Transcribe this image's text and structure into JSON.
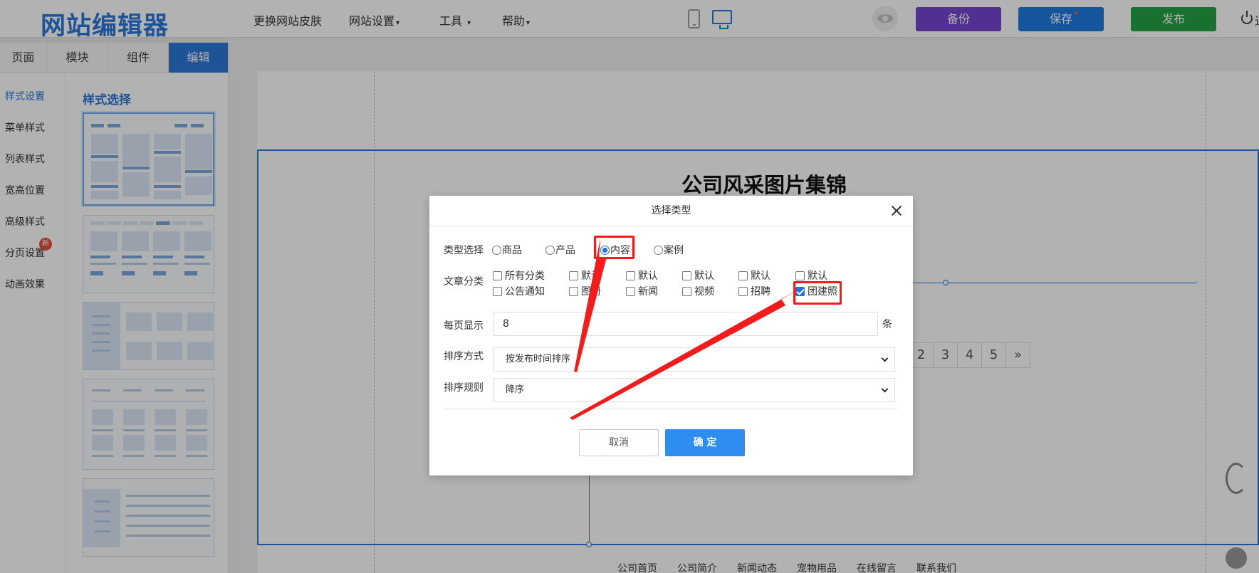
{
  "app": {
    "logo": "网站编辑器",
    "menu": [
      {
        "label": "更换网站皮肤",
        "dropdown": false
      },
      {
        "label": "网站设置",
        "dropdown": true
      },
      {
        "label": "工具",
        "dropdown": true
      },
      {
        "label": "帮助",
        "dropdown": true
      }
    ],
    "buttons": {
      "backup": "备份",
      "save": "保存",
      "publish": "发布"
    },
    "user_text": "退",
    "colors": {
      "backup": "#7546d0",
      "save": "#1f7ae0",
      "publish": "#25a244",
      "accent": "#2b79d8",
      "annotation": "#f41b1b"
    }
  },
  "left_tabs": [
    {
      "label": "页面",
      "active": false
    },
    {
      "label": "模块",
      "active": false
    },
    {
      "label": "组件",
      "active": false
    },
    {
      "label": "编辑",
      "active": true
    }
  ],
  "side_nav": [
    {
      "label": "样式设置",
      "active": true
    },
    {
      "label": "菜单样式",
      "active": false
    },
    {
      "label": "列表样式",
      "active": false
    },
    {
      "label": "宽高位置",
      "active": false
    },
    {
      "label": "高级样式",
      "active": false
    },
    {
      "label": "分页设置",
      "active": false,
      "badge": "新"
    },
    {
      "label": "动画效果",
      "active": false
    }
  ],
  "style_panel": {
    "title": "样式选择"
  },
  "canvas": {
    "section_title": "公司风采图片集锦",
    "pager": [
      "2",
      "3",
      "4",
      "5",
      "»"
    ],
    "footer_links": [
      "公司首页",
      "公司简介",
      "新闻动态",
      "宠物用品",
      "在线留言",
      "联系我们"
    ]
  },
  "modal": {
    "title": "选择类型",
    "type_label": "类型选择",
    "types": [
      {
        "label": "商品",
        "checked": false
      },
      {
        "label": "产品",
        "checked": false
      },
      {
        "label": "内容",
        "checked": true
      },
      {
        "label": "案例",
        "checked": false
      }
    ],
    "category_label": "文章分类",
    "categories": [
      {
        "label": "所有分类",
        "checked": false
      },
      {
        "label": "默认",
        "checked": false
      },
      {
        "label": "默认",
        "checked": false
      },
      {
        "label": "默认",
        "checked": false
      },
      {
        "label": "默认",
        "checked": false
      },
      {
        "label": "默认",
        "checked": false
      },
      {
        "label": "公告通知",
        "checked": false
      },
      {
        "label": "图册",
        "checked": false
      },
      {
        "label": "新闻",
        "checked": false
      },
      {
        "label": "视频",
        "checked": false
      },
      {
        "label": "招聘",
        "checked": false
      },
      {
        "label": "团建照",
        "checked": true
      }
    ],
    "per_page_label": "每页显示",
    "per_page_value": "8",
    "per_page_unit": "条",
    "sort_method_label": "排序方式",
    "sort_method_value": "按发布时间排序",
    "sort_rule_label": "排序规则",
    "sort_rule_value": "降序",
    "cancel": "取消",
    "confirm": "确 定"
  }
}
